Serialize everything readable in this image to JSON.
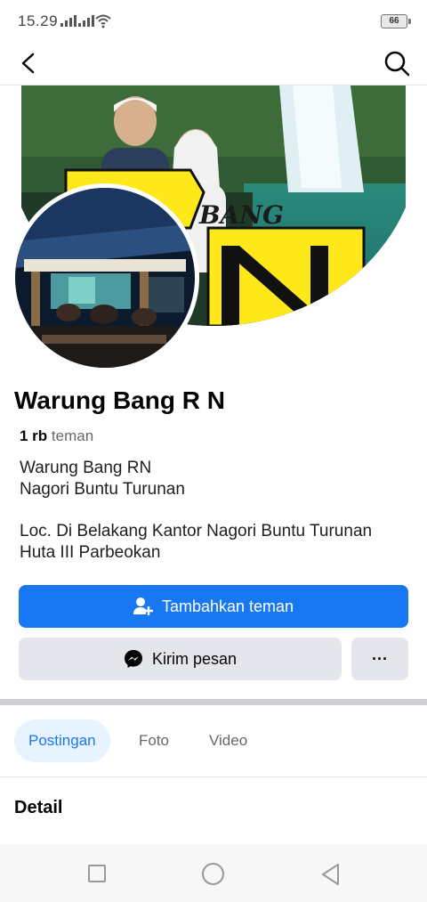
{
  "status_bar": {
    "time": "15.29",
    "battery": "66"
  },
  "profile": {
    "cover_text": "BANG",
    "name": "Warung Bang R N",
    "friends_count": "1 rb",
    "friends_label": "teman",
    "bio_line1": "Warung Bang RN",
    "bio_line2": "Nagori Buntu Turunan",
    "bio_line3": "Loc. Di Belakang Kantor Nagori Buntu Turunan",
    "bio_line4": "Huta III Parbeokan"
  },
  "actions": {
    "add_friend": "Tambahkan teman",
    "message": "Kirim pesan",
    "more": "···"
  },
  "tabs": [
    {
      "label": "Postingan",
      "active": true
    },
    {
      "label": "Foto",
      "active": false
    },
    {
      "label": "Video",
      "active": false
    }
  ],
  "sections": {
    "detail": "Detail"
  },
  "colors": {
    "accent": "#1877f2",
    "tab_active_bg": "#e7f3ff",
    "secondary_button": "#e4e6eb"
  }
}
